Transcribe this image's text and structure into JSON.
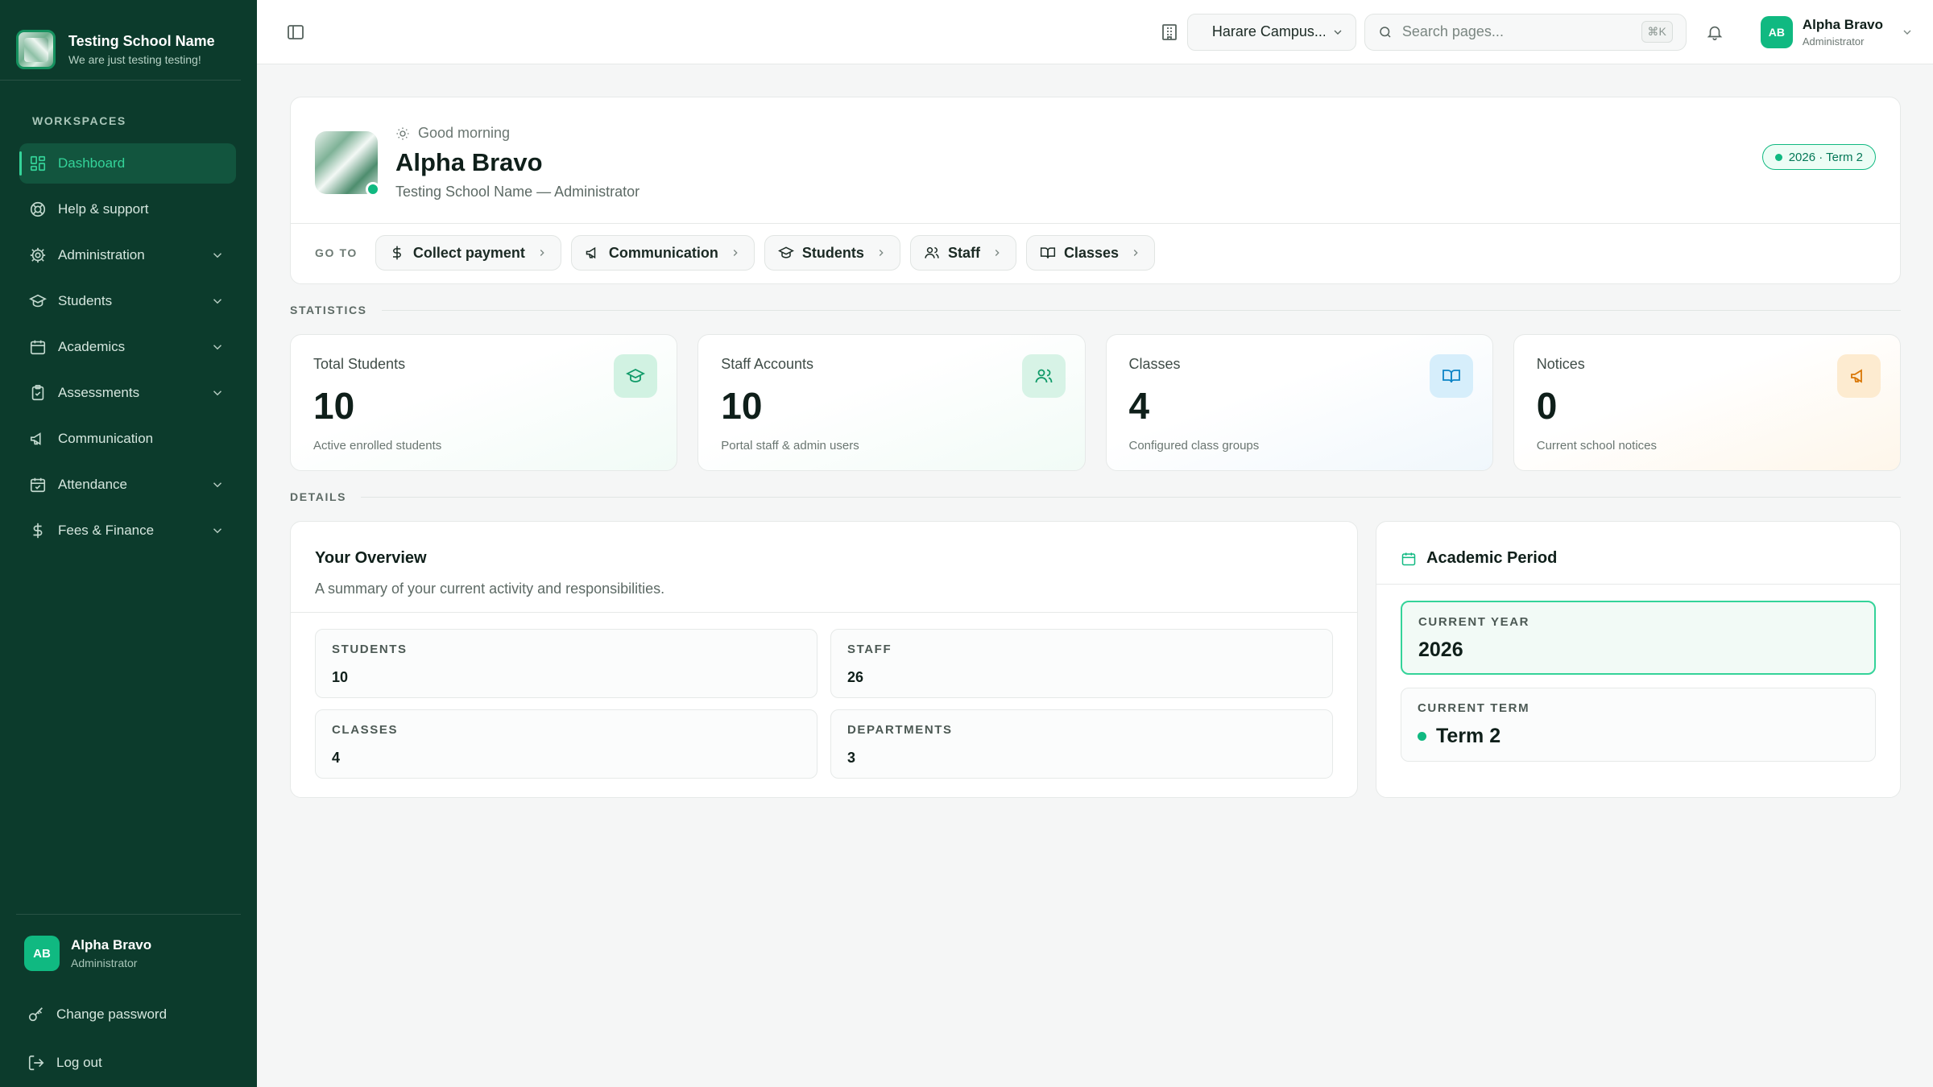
{
  "brand": {
    "name": "Testing School Name",
    "tagline": "We are just testing testing!"
  },
  "sidebar": {
    "section_label": "WORKSPACES",
    "items": [
      {
        "label": "Dashboard",
        "icon": "dashboard-icon",
        "active": true,
        "expandable": false
      },
      {
        "label": "Help & support",
        "icon": "lifebuoy-icon",
        "expandable": false
      },
      {
        "label": "Administration",
        "icon": "gear-icon",
        "expandable": true
      },
      {
        "label": "Students",
        "icon": "graduation-cap-icon",
        "expandable": true
      },
      {
        "label": "Academics",
        "icon": "calendar-icon",
        "expandable": true
      },
      {
        "label": "Assessments",
        "icon": "clipboard-check-icon",
        "expandable": true
      },
      {
        "label": "Communication",
        "icon": "megaphone-icon",
        "expandable": false
      },
      {
        "label": "Attendance",
        "icon": "calendar-check-icon",
        "expandable": true
      },
      {
        "label": "Fees & Finance",
        "icon": "dollar-icon",
        "expandable": true
      }
    ],
    "user": {
      "initials": "AB",
      "name": "Alpha Bravo",
      "role": "Administrator"
    },
    "change_password": "Change password",
    "logout": "Log out"
  },
  "topbar": {
    "campus": "Harare Campus...",
    "search_placeholder": "Search pages...",
    "search_shortcut": "⌘K",
    "user": {
      "initials": "AB",
      "name": "Alpha Bravo",
      "role": "Administrator"
    }
  },
  "welcome": {
    "greeting": "Good morning",
    "name": "Alpha Bravo",
    "subtitle": "Testing School Name — Administrator",
    "term_badge": "2026 · Term 2",
    "goto_label": "GO TO",
    "shortcuts": [
      {
        "label": "Collect payment",
        "icon": "dollar-icon"
      },
      {
        "label": "Communication",
        "icon": "megaphone-icon"
      },
      {
        "label": "Students",
        "icon": "graduation-cap-icon"
      },
      {
        "label": "Staff",
        "icon": "users-icon"
      },
      {
        "label": "Classes",
        "icon": "book-open-icon"
      }
    ]
  },
  "statistics": {
    "label": "STATISTICS",
    "cards": [
      {
        "label": "Total Students",
        "value": "10",
        "sub": "Active enrolled students",
        "icon": "graduation-cap-icon",
        "accent": "#10b981"
      },
      {
        "label": "Staff Accounts",
        "value": "10",
        "sub": "Portal staff & admin users",
        "icon": "users-icon",
        "accent": "#10b981"
      },
      {
        "label": "Classes",
        "value": "4",
        "sub": "Configured class groups",
        "icon": "book-open-icon",
        "accent": "#0ea5e9"
      },
      {
        "label": "Notices",
        "value": "0",
        "sub": "Current school notices",
        "icon": "megaphone-icon",
        "accent": "#f59e0b"
      }
    ]
  },
  "details": {
    "label": "DETAILS",
    "overview": {
      "title": "Your Overview",
      "subtitle": "A summary of your current activity and responsibilities.",
      "cells": [
        {
          "key": "STUDENTS",
          "value": "10"
        },
        {
          "key": "STAFF",
          "value": "26"
        },
        {
          "key": "CLASSES",
          "value": "4"
        },
        {
          "key": "DEPARTMENTS",
          "value": "3"
        }
      ]
    },
    "period": {
      "title": "Academic Period",
      "year_label": "CURRENT YEAR",
      "year": "2026",
      "term_label": "CURRENT TERM",
      "term": "Term 2"
    }
  }
}
